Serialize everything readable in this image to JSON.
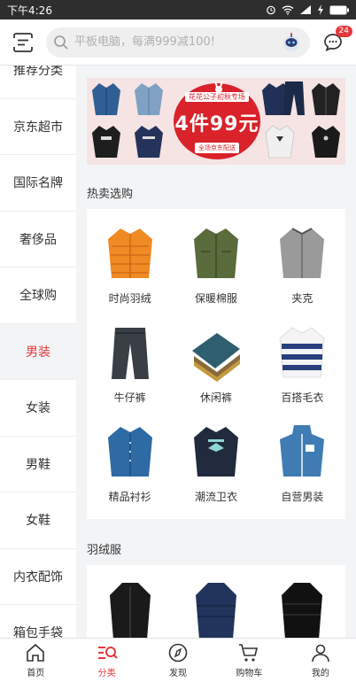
{
  "status": {
    "time": "下午4:26"
  },
  "header": {
    "search_placeholder": "平板电脑，每满999减100!",
    "message_count": "24"
  },
  "sidebar": {
    "items": [
      {
        "label": "推荐分类"
      },
      {
        "label": "京东超市"
      },
      {
        "label": "国际名牌"
      },
      {
        "label": "奢侈品"
      },
      {
        "label": "全球购"
      },
      {
        "label": "男装"
      },
      {
        "label": "女装"
      },
      {
        "label": "男鞋"
      },
      {
        "label": "女鞋"
      },
      {
        "label": "内衣配饰"
      },
      {
        "label": "箱包手袋"
      }
    ],
    "active_index": 5
  },
  "banner": {
    "top_text": "花花公子初秋专场",
    "main_text": "4件99元",
    "sub_text": "全场京东配送"
  },
  "sections": [
    {
      "title": "热卖选购",
      "products": [
        {
          "label": "时尚羽绒",
          "icon": "down-jacket-icon"
        },
        {
          "label": "保暖棉服",
          "icon": "cotton-jacket-icon"
        },
        {
          "label": "夹克",
          "icon": "jacket-icon"
        },
        {
          "label": "牛仔裤",
          "icon": "jeans-icon"
        },
        {
          "label": "休闲裤",
          "icon": "pants-icon"
        },
        {
          "label": "百搭毛衣",
          "icon": "sweater-icon"
        },
        {
          "label": "精品衬衫",
          "icon": "shirt-icon"
        },
        {
          "label": "潮流卫衣",
          "icon": "sweatshirt-icon"
        },
        {
          "label": "自营男装",
          "icon": "hoodie-icon"
        }
      ]
    },
    {
      "title": "羽绒服",
      "products": [
        {
          "label": "",
          "icon": "long-coat-icon"
        },
        {
          "label": "",
          "icon": "navy-down-icon"
        },
        {
          "label": "",
          "icon": "black-down-icon"
        }
      ]
    }
  ],
  "tabbar": {
    "items": [
      {
        "label": "首页",
        "icon": "home-icon"
      },
      {
        "label": "分类",
        "icon": "category-icon"
      },
      {
        "label": "发现",
        "icon": "discover-icon"
      },
      {
        "label": "购物车",
        "icon": "cart-icon"
      },
      {
        "label": "我的",
        "icon": "user-icon"
      }
    ],
    "active_index": 1
  },
  "colors": {
    "accent": "#e4393c",
    "background": "#f3f4f6",
    "status_bar": "#2e2e2e"
  }
}
